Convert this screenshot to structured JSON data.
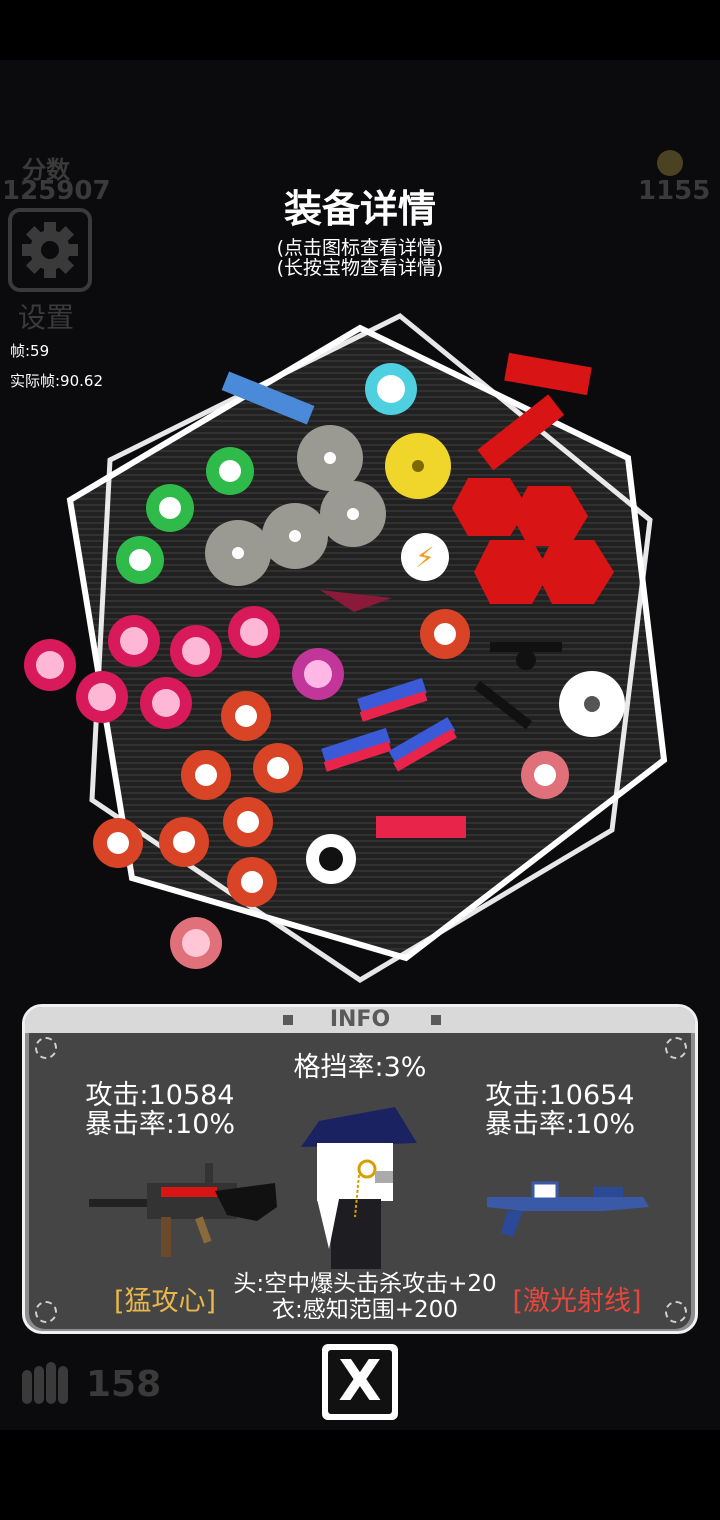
{
  "hud": {
    "score_label": "分数",
    "score_value": "125907",
    "coins": "1155",
    "settings_label": "设置",
    "fps": "帧:59",
    "actual_fps": "实际帧:90.62",
    "ammo_count": "158"
  },
  "overlay": {
    "title": "装备详情",
    "hint_1": "(点击图标查看详情)",
    "hint_2": "(长按宝物查看详情)"
  },
  "info_panel": {
    "header": "INFO",
    "block_rate": "格挡率:3%",
    "left_weapon": {
      "attack": "攻击:10584",
      "crit": "暴击率:10%",
      "trait": "[猛攻心]",
      "trait_color": "#e8b64a"
    },
    "right_weapon": {
      "attack": "攻击:10654",
      "crit": "暴击率:10%",
      "trait": "[激光射线]",
      "trait_color": "#e8473a"
    },
    "head_bonus": "头:空中爆头击杀攻击+20",
    "body_bonus": "衣:感知范围+200"
  },
  "close_button": {
    "label": "X"
  },
  "colors": {
    "red_gear": "#d94426",
    "pink_gear": "#d8195a",
    "green_gear": "#2fbb4a",
    "grey_gear": "#9a9a92",
    "hex_outline": "#ffffff"
  }
}
